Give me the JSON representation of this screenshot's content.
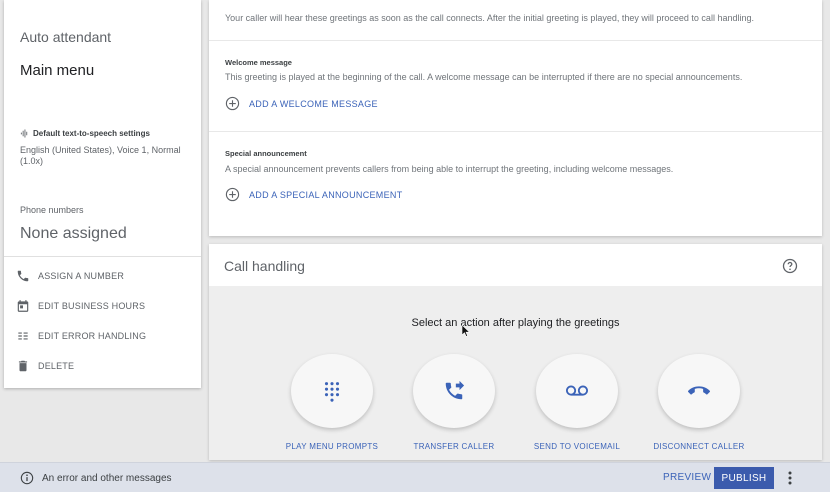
{
  "left_panel": {
    "type_label": "Auto attendant",
    "title": "Main menu",
    "tts_heading": "Default text-to-speech settings",
    "tts_value": "English (United States), Voice 1, Normal (1.0x)",
    "phone_label": "Phone numbers",
    "phone_value": "None assigned",
    "actions": [
      {
        "label": "ASSIGN A NUMBER",
        "icon": "phone-icon"
      },
      {
        "label": "EDIT BUSINESS HOURS",
        "icon": "calendar-icon"
      },
      {
        "label": "EDIT ERROR HANDLING",
        "icon": "error-handling-icon"
      },
      {
        "label": "DELETE",
        "icon": "trash-icon"
      }
    ]
  },
  "greetings": {
    "intro": "Your caller will hear these greetings as soon as the call connects. After the initial greeting is played, they will proceed to call handling.",
    "welcome": {
      "title": "Welcome message",
      "description": "This greeting is played at the beginning of the call. A welcome message can be interrupted if there are no special announcements.",
      "add_label": "ADD A WELCOME MESSAGE"
    },
    "special": {
      "title": "Special announcement",
      "description": "A special announcement prevents callers from being able to interrupt the greeting, including welcome messages.",
      "add_label": "ADD A SPECIAL ANNOUNCEMENT"
    }
  },
  "call_handling": {
    "title": "Call handling",
    "prompt": "Select an action after playing the greetings",
    "actions": [
      {
        "label": "PLAY MENU PROMPTS",
        "icon": "dialpad-icon"
      },
      {
        "label": "TRANSFER CALLER",
        "icon": "phone-forward-icon"
      },
      {
        "label": "SEND TO VOICEMAIL",
        "icon": "voicemail-icon"
      },
      {
        "label": "DISCONNECT CALLER",
        "icon": "call-end-icon"
      }
    ]
  },
  "bottom_bar": {
    "message": "An error and other messages",
    "preview_label": "PREVIEW",
    "publish_label": "PUBLISH"
  },
  "colors": {
    "accent": "#3b63b8",
    "publish": "#3b5bad",
    "bottom_bar": "#dde1ea"
  }
}
